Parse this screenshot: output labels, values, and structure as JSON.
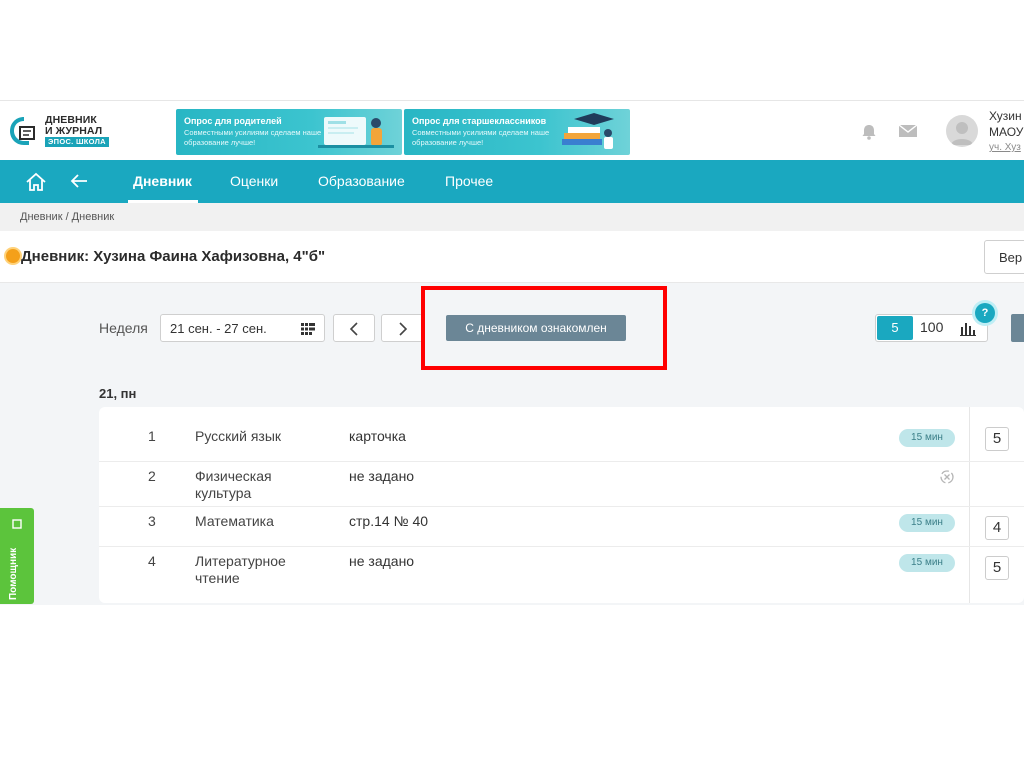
{
  "header": {
    "logo_line1": "ДНЕВНИК",
    "logo_line2": "И ЖУРНАЛ",
    "logo_sub": "ЭПОС. ШКОЛА",
    "banners": [
      {
        "title": "Опрос для родителей",
        "subtitle": "Совместными усилиями сделаем наше образование лучше!"
      },
      {
        "title": "Опрос для старшеклассников",
        "subtitle": "Совместными усилиями сделаем наше образование лучше!"
      }
    ],
    "icons": {
      "bell": "bell-icon",
      "mail": "mail-icon"
    },
    "user": {
      "name": "Хузин",
      "org": "МАОУ",
      "sub": "уч. Хуз"
    }
  },
  "nav": {
    "icons": {
      "home": "home-icon",
      "back": "back-arrow-icon"
    },
    "items": [
      {
        "label": "Дневник",
        "active": true
      },
      {
        "label": "Оценки",
        "active": false
      },
      {
        "label": "Образование",
        "active": false
      },
      {
        "label": "Прочее",
        "active": false
      }
    ]
  },
  "breadcrumb": "Дневник / Дневник",
  "title": "Дневник: Хузина Фаина Хафизовна, 4\"б\"",
  "version_button": "Вер",
  "controls": {
    "week_label": "Неделя",
    "date_range": "21 сен. - 27 сен.",
    "ack_button": "С дневником ознакомлен",
    "scale_5": "5",
    "scale_100": "100",
    "help": "?"
  },
  "day": {
    "label": "21, пн",
    "lessons": [
      {
        "num": "1",
        "subject": "Русский язык",
        "homework": "карточка",
        "duration": "15 мин",
        "grade": "5"
      },
      {
        "num": "2",
        "subject": "Физическая культура",
        "homework": "не задано",
        "duration": "",
        "grade": ""
      },
      {
        "num": "3",
        "subject": "Математика",
        "homework": "стр.14 № 40",
        "duration": "15 мин",
        "grade": "4"
      },
      {
        "num": "4",
        "subject": "Литературное чтение",
        "homework": "не задано",
        "duration": "15 мин",
        "grade": "5"
      }
    ]
  },
  "assistant": "Помощник",
  "colors": {
    "accent": "#1aa8c0",
    "ack": "#6b8696",
    "highlight": "#ff0000",
    "assistant": "#5cc43c",
    "pill": "#bfe6ea"
  }
}
